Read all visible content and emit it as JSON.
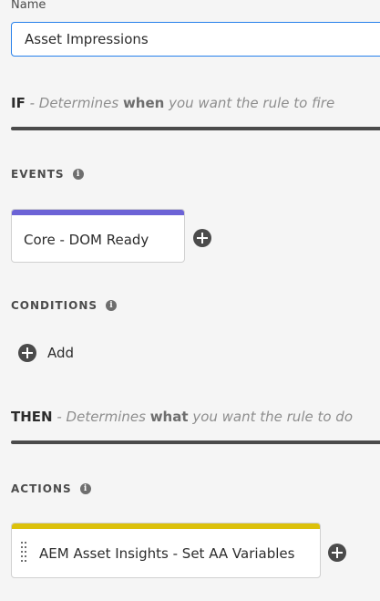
{
  "name_field": {
    "label": "Name",
    "value": "Asset Impressions"
  },
  "if_section": {
    "keyword": "IF",
    "text_before": " - Determines ",
    "emphasis": "when",
    "text_after": " you want the rule to fire"
  },
  "events": {
    "label": "EVENTS",
    "items": [
      {
        "label": "Core - DOM Ready",
        "bar_color": "#6c63d6"
      }
    ]
  },
  "conditions": {
    "label": "CONDITIONS",
    "add_label": "Add"
  },
  "then_section": {
    "keyword": "THEN",
    "text_before": " - Determines ",
    "emphasis": "what",
    "text_after": " you want the rule to do"
  },
  "actions": {
    "label": "ACTIONS",
    "items": [
      {
        "label": "AEM Asset Insights - Set AA Variables",
        "bar_color": "#dcc10b"
      }
    ]
  },
  "icons": {
    "info": "info-icon",
    "add": "plus-circle-icon",
    "drag": "drag-handle-icon"
  }
}
